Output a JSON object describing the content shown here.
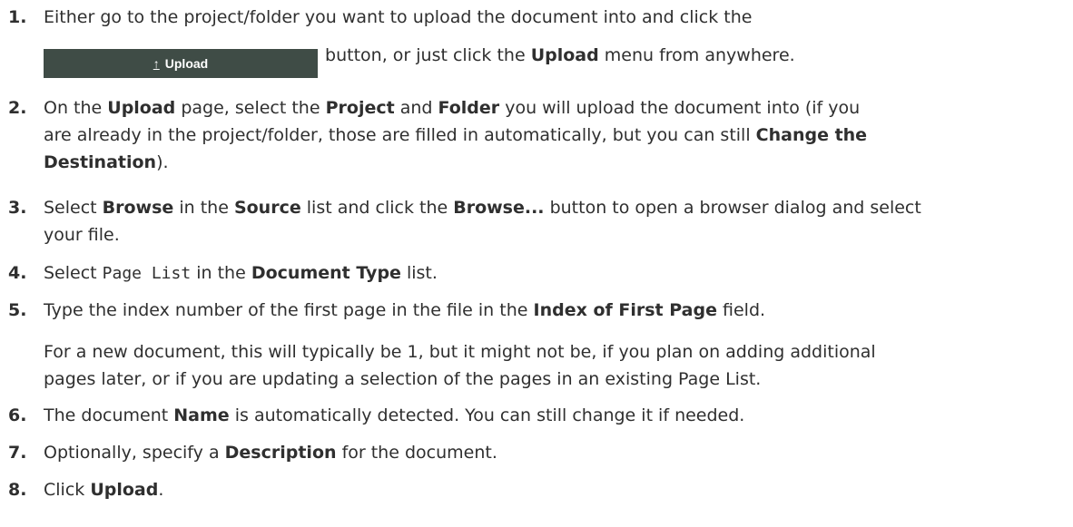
{
  "steps": [
    {
      "number": "1.",
      "line1": "Either go to the project/folder you want to upload the document into and click the",
      "button_label": "Upload",
      "button_icon": "upload-arrow-icon",
      "line2_a": "button, or just click the ",
      "line2_b": "Upload",
      "line2_c": " menu from anywhere."
    },
    {
      "number": "2.",
      "p1": "On the ",
      "b1": "Upload",
      "p2": " page, select the ",
      "b2": "Project",
      "p3": " and ",
      "b3": "Folder",
      "p4": " you will upload the document into (if you",
      "line2": "are already in the project/folder, those are filled in automatically, but you can still ",
      "b4": "Change the",
      "b5": "Destination",
      "p5": ")."
    },
    {
      "number": "3.",
      "p1": "Select ",
      "b1": "Browse",
      "p2": " in the ",
      "b2": "Source",
      "p3": " list and click the ",
      "b3": "Browse...",
      "p4": " button to open a browser dialog and select",
      "line2": "your file."
    },
    {
      "number": "4.",
      "p1": "Select ",
      "code": "Page List",
      "p2": " in the ",
      "b1": "Document Type",
      "p3": " list."
    },
    {
      "number": "5.",
      "p1": "Type the index number of the first page in the file in the ",
      "b1": "Index of First Page",
      "p2": " field.",
      "note_line1": "For a new document, this will typically be 1, but it might not be, if you plan on adding additional",
      "note_line2": "pages later, or if you are updating a selection of the pages in an existing Page List."
    },
    {
      "number": "6.",
      "p1": "The document ",
      "b1": "Name",
      "p2": " is automatically detected. You can still change it if needed."
    },
    {
      "number": "7.",
      "p1": "Optionally, specify a ",
      "b1": "Description",
      "p2": " for the document."
    },
    {
      "number": "8.",
      "p1": "Click ",
      "b1": "Upload",
      "p2": "."
    }
  ],
  "colors": {
    "text": "#2f2f2f",
    "button_bg": "#3f4c46",
    "button_text": "#ffffff"
  }
}
